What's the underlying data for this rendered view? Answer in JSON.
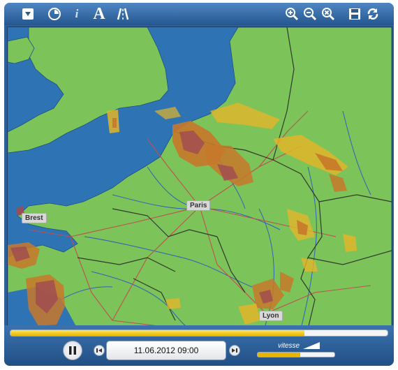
{
  "toolbar": {
    "icons": [
      "menu-dropdown-icon",
      "animation-icon",
      "info-icon",
      "font-labels-icon",
      "roads-icon",
      "zoom-in-icon",
      "zoom-out-icon",
      "zoom-reset-icon",
      "save-icon",
      "refresh-icon"
    ],
    "labels_glyph": "A",
    "info_glyph": "i"
  },
  "map": {
    "cities": [
      {
        "name": "Paris"
      },
      {
        "name": "Brest"
      },
      {
        "name": "Lyon"
      }
    ],
    "colors": {
      "sea": "#2e74b5",
      "land": "#7cc35a",
      "precip_low": "#e2b52a",
      "precip_mid": "#c8782a",
      "precip_high": "#a04a52"
    }
  },
  "player": {
    "progress_fraction": 0.78,
    "datetime": "11.06.2012 09:00",
    "speed_label": "vitesse",
    "speed_fraction": 0.55,
    "icons": [
      "pause-icon",
      "step-back-icon",
      "step-forward-icon"
    ]
  }
}
